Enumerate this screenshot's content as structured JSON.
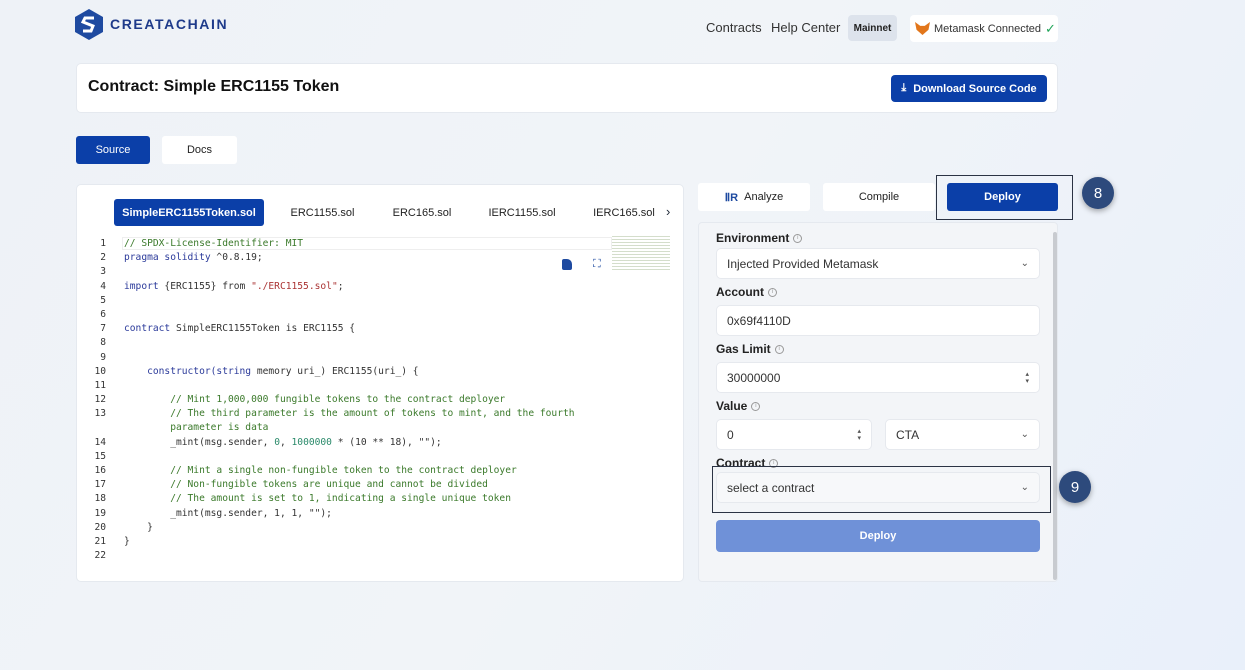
{
  "brand": {
    "name": "CREATACHAIN",
    "color": "#1e4aa0"
  },
  "nav": {
    "contracts": "Contracts",
    "help": "Help Center",
    "network": "Mainnet",
    "wallet": "Metamask Connected"
  },
  "header": {
    "title": "Contract: Simple ERC1155 Token",
    "download": "Download Source Code"
  },
  "view_tabs": {
    "source": "Source",
    "docs": "Docs",
    "active": "Source"
  },
  "files": [
    "SimpleERC1155Token.sol",
    "ERC1155.sol",
    "ERC165.sol",
    "IERC1155.sol",
    "IERC165.sol"
  ],
  "code": [
    {
      "n": "1",
      "seg": [
        [
          "// SPDX-License-Identifier: MIT",
          "cm"
        ]
      ]
    },
    {
      "n": "2",
      "seg": [
        [
          "pragma solidity",
          "kw"
        ],
        [
          " ^0.8.19;",
          "tx"
        ]
      ]
    },
    {
      "n": "3",
      "seg": []
    },
    {
      "n": "4",
      "seg": [
        [
          "import",
          "kw"
        ],
        [
          " {ERC1155} from ",
          "tx"
        ],
        [
          "\"./ERC1155.sol\"",
          "st"
        ],
        [
          ";",
          "tx"
        ]
      ]
    },
    {
      "n": "5",
      "seg": []
    },
    {
      "n": "6",
      "seg": []
    },
    {
      "n": "7",
      "seg": [
        [
          "contract",
          "kw"
        ],
        [
          " SimpleERC1155Token is ERC1155 {",
          "tx"
        ]
      ]
    },
    {
      "n": "8",
      "seg": []
    },
    {
      "n": "9",
      "seg": []
    },
    {
      "n": "10",
      "seg": [
        [
          "    constructor(",
          "kw"
        ],
        [
          "string",
          "kw"
        ],
        [
          " memory uri_) ERC1155(uri_) {",
          "tx"
        ]
      ]
    },
    {
      "n": "11",
      "seg": []
    },
    {
      "n": "12",
      "seg": [
        [
          "        // Mint 1,000,000 fungible tokens to the contract deployer",
          "cm"
        ]
      ]
    },
    {
      "n": "13",
      "seg": [
        [
          "        // The third parameter is the amount of tokens to mint, and the fourth",
          "cm"
        ]
      ]
    },
    {
      "n": "",
      "seg": [
        [
          "        parameter is data",
          "cm"
        ]
      ]
    },
    {
      "n": "14",
      "seg": [
        [
          "        _mint(msg.sender, ",
          "tx"
        ],
        [
          "0",
          "nm"
        ],
        [
          ", ",
          "tx"
        ],
        [
          "1000000",
          "nm"
        ],
        [
          " * (10 ** 18), \"\");",
          "tx"
        ]
      ]
    },
    {
      "n": "15",
      "seg": []
    },
    {
      "n": "16",
      "seg": [
        [
          "        // Mint a single non-fungible token to the contract deployer",
          "cm"
        ]
      ]
    },
    {
      "n": "17",
      "seg": [
        [
          "        // Non-fungible tokens are unique and cannot be divided",
          "cm"
        ]
      ]
    },
    {
      "n": "18",
      "seg": [
        [
          "        // The amount is set to 1, indicating a single unique token",
          "cm"
        ]
      ]
    },
    {
      "n": "19",
      "seg": [
        [
          "        _mint(msg.sender, 1, 1, \"\");",
          "tx"
        ]
      ]
    },
    {
      "n": "20",
      "seg": [
        [
          "    }",
          "tx"
        ]
      ]
    },
    {
      "n": "21",
      "seg": [
        [
          "}",
          "tx"
        ]
      ]
    },
    {
      "n": "22",
      "seg": []
    }
  ],
  "actions": {
    "analyze": "Analyze",
    "compile": "Compile",
    "deploy": "Deploy",
    "active": "Deploy"
  },
  "form": {
    "environment": {
      "label": "Environment",
      "value": "Injected Provided Metamask"
    },
    "account": {
      "label": "Account",
      "value": "0x69f4110D"
    },
    "gas": {
      "label": "Gas Limit",
      "value": "30000000"
    },
    "value": {
      "label": "Value",
      "value": "0",
      "unit": "CTA"
    },
    "contract": {
      "label": "Contract",
      "placeholder": "select a contract"
    },
    "deploy": "Deploy"
  },
  "annotations": {
    "step8": "8",
    "step9": "9"
  }
}
